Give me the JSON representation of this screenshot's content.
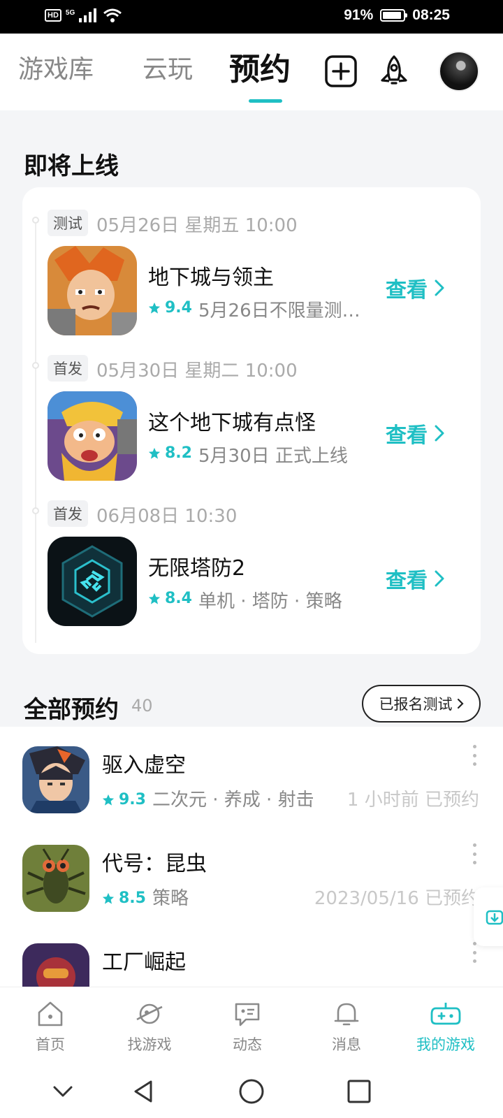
{
  "status_bar": {
    "hd": "HD",
    "network": "5G",
    "battery_percent": "91%",
    "battery_level": 0.91,
    "time": "08:25"
  },
  "top_nav": {
    "tabs": [
      {
        "label": "游戏库"
      },
      {
        "label": "云玩"
      },
      {
        "label": "预约",
        "active": true
      }
    ],
    "icons": [
      "add-square-icon",
      "rocket-icon",
      "avatar"
    ]
  },
  "upcoming": {
    "title": "即将上线",
    "items": [
      {
        "tag": "测试",
        "date": "05月26日 星期五 10:00",
        "name": "地下城与领主",
        "rating": "9.4",
        "desc": "5月26日不限量测…",
        "action": "查看"
      },
      {
        "tag": "首发",
        "date": "05月30日 星期二 10:00",
        "name": "这个地下城有点怪",
        "rating": "8.2",
        "desc": "5月30日 正式上线",
        "action": "查看"
      },
      {
        "tag": "首发",
        "date": "06月08日 10:30",
        "name": "无限塔防2",
        "rating": "8.4",
        "desc": "单机 · 塔防 · 策略",
        "action": "查看"
      }
    ]
  },
  "all_reservations": {
    "title": "全部预约",
    "count": "40",
    "filter_button": "已报名测试",
    "items": [
      {
        "name": "驱入虚空",
        "rating": "9.3",
        "tags": "二次元 · 养成 · 射击",
        "status": "1 小时前 已预约"
      },
      {
        "name": "代号：昆虫",
        "rating": "8.5",
        "tags": "策略",
        "status": "2023/05/16 已预约"
      },
      {
        "name": "工厂崛起",
        "rating": "",
        "tags": "",
        "status": ""
      }
    ]
  },
  "bottom_tabs": [
    {
      "label": "首页",
      "icon": "home-icon"
    },
    {
      "label": "找游戏",
      "icon": "planet-icon"
    },
    {
      "label": "动态",
      "icon": "chat-icon"
    },
    {
      "label": "消息",
      "icon": "bell-icon"
    },
    {
      "label": "我的游戏",
      "icon": "gamepad-icon",
      "active": true
    }
  ],
  "colors": {
    "accent": "#1fbfc4",
    "background": "#f4f5f7"
  }
}
